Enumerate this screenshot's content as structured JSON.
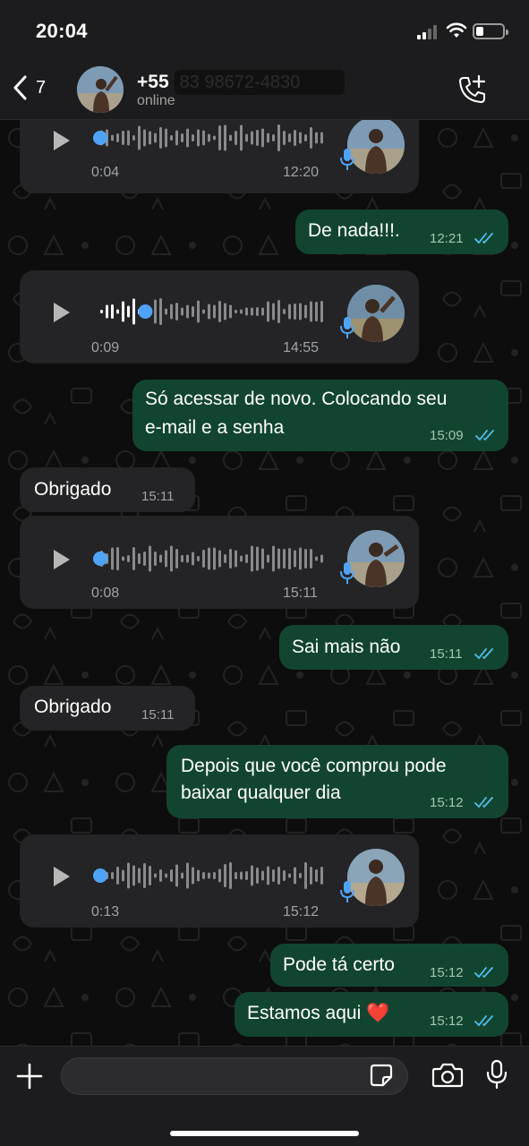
{
  "status_bar": {
    "time": "20:04"
  },
  "header": {
    "back_count": "7",
    "contact_prefix": "+55",
    "contact_redacted": "83 98672-4830",
    "status": "online"
  },
  "messages": [
    {
      "type": "voice",
      "dir": "in",
      "duration": "0:04",
      "time": "12:20",
      "progress": 0
    },
    {
      "type": "text",
      "dir": "out",
      "text": "De nada!!!.",
      "time": "12:21",
      "read": true
    },
    {
      "type": "voice",
      "dir": "in",
      "duration": "0:09",
      "time": "14:55",
      "progress": 0.2
    },
    {
      "type": "text",
      "dir": "out",
      "lines": [
        "Só acessar de novo. Colocando seu",
        "e-mail e a senha"
      ],
      "time": "15:09",
      "read": true
    },
    {
      "type": "text",
      "dir": "in",
      "text": "Obrigado",
      "time": "15:11"
    },
    {
      "type": "voice",
      "dir": "in",
      "duration": "0:08",
      "time": "15:11",
      "progress": 0
    },
    {
      "type": "text",
      "dir": "out",
      "text": "Sai mais não",
      "time": "15:11",
      "read": true
    },
    {
      "type": "text",
      "dir": "in",
      "text": "Obrigado",
      "time": "15:11"
    },
    {
      "type": "text",
      "dir": "out",
      "lines": [
        "Depois que você comprou pode",
        "baixar qualquer dia"
      ],
      "time": "15:12",
      "read": true
    },
    {
      "type": "voice",
      "dir": "in",
      "duration": "0:13",
      "time": "15:12",
      "progress": 0
    },
    {
      "type": "text",
      "dir": "out",
      "text": "Pode tá certo",
      "time": "15:12",
      "read": true
    },
    {
      "type": "text",
      "dir": "out",
      "text": "Estamos aqui ❤️",
      "time": "15:12",
      "read": true
    }
  ],
  "composer": {
    "placeholder": ""
  },
  "colors": {
    "outgoing": "#124530",
    "incoming": "#242426",
    "tick_read": "#53bdeb",
    "accent_blue": "#4fa3f7"
  }
}
